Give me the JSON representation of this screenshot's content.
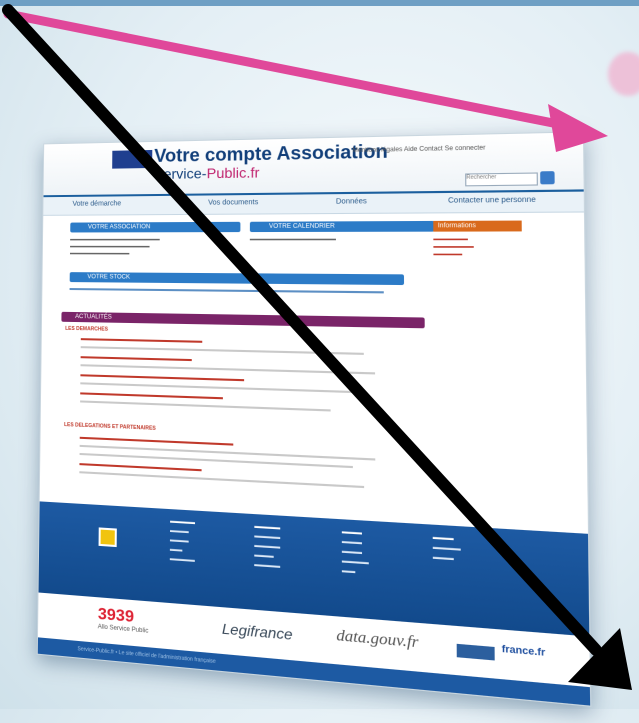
{
  "site": {
    "title": "Votre compte Association",
    "subtitle_a": "Service-",
    "subtitle_b": "Public.fr",
    "header_links": "Mentions légales   Aide   Contact   Se connecter",
    "search_placeholder": "Rechercher"
  },
  "nav": {
    "items": [
      "Votre démarche",
      "Vos documents",
      "Données",
      "Contacter une personne"
    ]
  },
  "sections": {
    "left_box_title": "VOTRE ASSOCIATION",
    "middle_box_title": "VOTRE CALENDRIER",
    "notice_title": "Informations",
    "stock_bar": "VOTRE STOCK",
    "main_bar": "ACTUALITÉS",
    "subhead_1": "LES DEMARCHES",
    "subhead_2": "LES DELEGATIONS ET PARTENAIRES"
  },
  "partners": {
    "p3939": "3939",
    "p3939_sub": "Allo Service Public",
    "legifrance": "Legifrance",
    "datagouv": "data.gouv.fr",
    "france": "france.fr"
  },
  "footer_strip": "Service-Public.fr   •   Le site officiel de l'administration française"
}
